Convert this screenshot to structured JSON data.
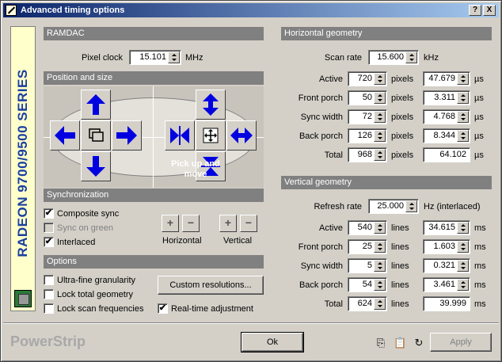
{
  "window": {
    "title": "Advanced timing options",
    "help_btn": "?",
    "close_btn": "X"
  },
  "banner": {
    "text": "RADEON 9700/9500 SERIES"
  },
  "ramdac": {
    "header": "RAMDAC",
    "pixel_clock_label": "Pixel clock",
    "pixel_clock_value": "15.101",
    "unit": "MHz"
  },
  "position": {
    "header": "Position and size",
    "pick_text": "Pick up and move"
  },
  "sync": {
    "header": "Synchronization",
    "composite": {
      "label": "Composite sync",
      "checked": "✔"
    },
    "sog": {
      "label": "Sync on green",
      "checked": ""
    },
    "interlaced": {
      "label": "Interlaced",
      "checked": "✔"
    },
    "plus": "+",
    "minus": "−",
    "horizontal_label": "Horizontal",
    "vertical_label": "Vertical"
  },
  "options": {
    "header": "Options",
    "ultra": {
      "label": "Ultra-fine granularity",
      "checked": ""
    },
    "lock_total": {
      "label": "Lock total geometry",
      "checked": ""
    },
    "lock_scan": {
      "label": "Lock scan frequencies",
      "checked": ""
    },
    "realtime": {
      "label": "Real-time adjustment",
      "checked": "✔"
    },
    "custom_btn": "Custom resolutions..."
  },
  "hgeo": {
    "header": "Horizontal geometry",
    "scan_label": "Scan rate",
    "scan_value": "15.600",
    "scan_unit": "kHz",
    "unit_px": "pixels",
    "unit_us": "µs",
    "rows": [
      {
        "label": "Active",
        "px": "720",
        "us": "47.679"
      },
      {
        "label": "Front porch",
        "px": "50",
        "us": "3.311"
      },
      {
        "label": "Sync width",
        "px": "72",
        "us": "4.768"
      },
      {
        "label": "Back porch",
        "px": "126",
        "us": "8.344"
      },
      {
        "label": "Total",
        "px": "968",
        "us": "64.102"
      }
    ]
  },
  "vgeo": {
    "header": "Vertical geometry",
    "refresh_label": "Refresh rate",
    "refresh_value": "25.000",
    "refresh_unit": "Hz (interlaced)",
    "unit_lines": "lines",
    "unit_ms": "ms",
    "rows": [
      {
        "label": "Active",
        "lines": "540",
        "ms": "34.615"
      },
      {
        "label": "Front porch",
        "lines": "25",
        "ms": "1.603"
      },
      {
        "label": "Sync width",
        "lines": "5",
        "ms": "0.321"
      },
      {
        "label": "Back porch",
        "lines": "54",
        "ms": "3.461"
      },
      {
        "label": "Total",
        "lines": "624",
        "ms": "39.999"
      }
    ]
  },
  "footer": {
    "brand": "PowerStrip",
    "ok": "Ok",
    "apply": "Apply"
  },
  "colors": {
    "title_start": "#0a246a",
    "title_end": "#a6caf0",
    "arrow_blue": "#0000e0",
    "banner_text": "#1a3fa0"
  }
}
